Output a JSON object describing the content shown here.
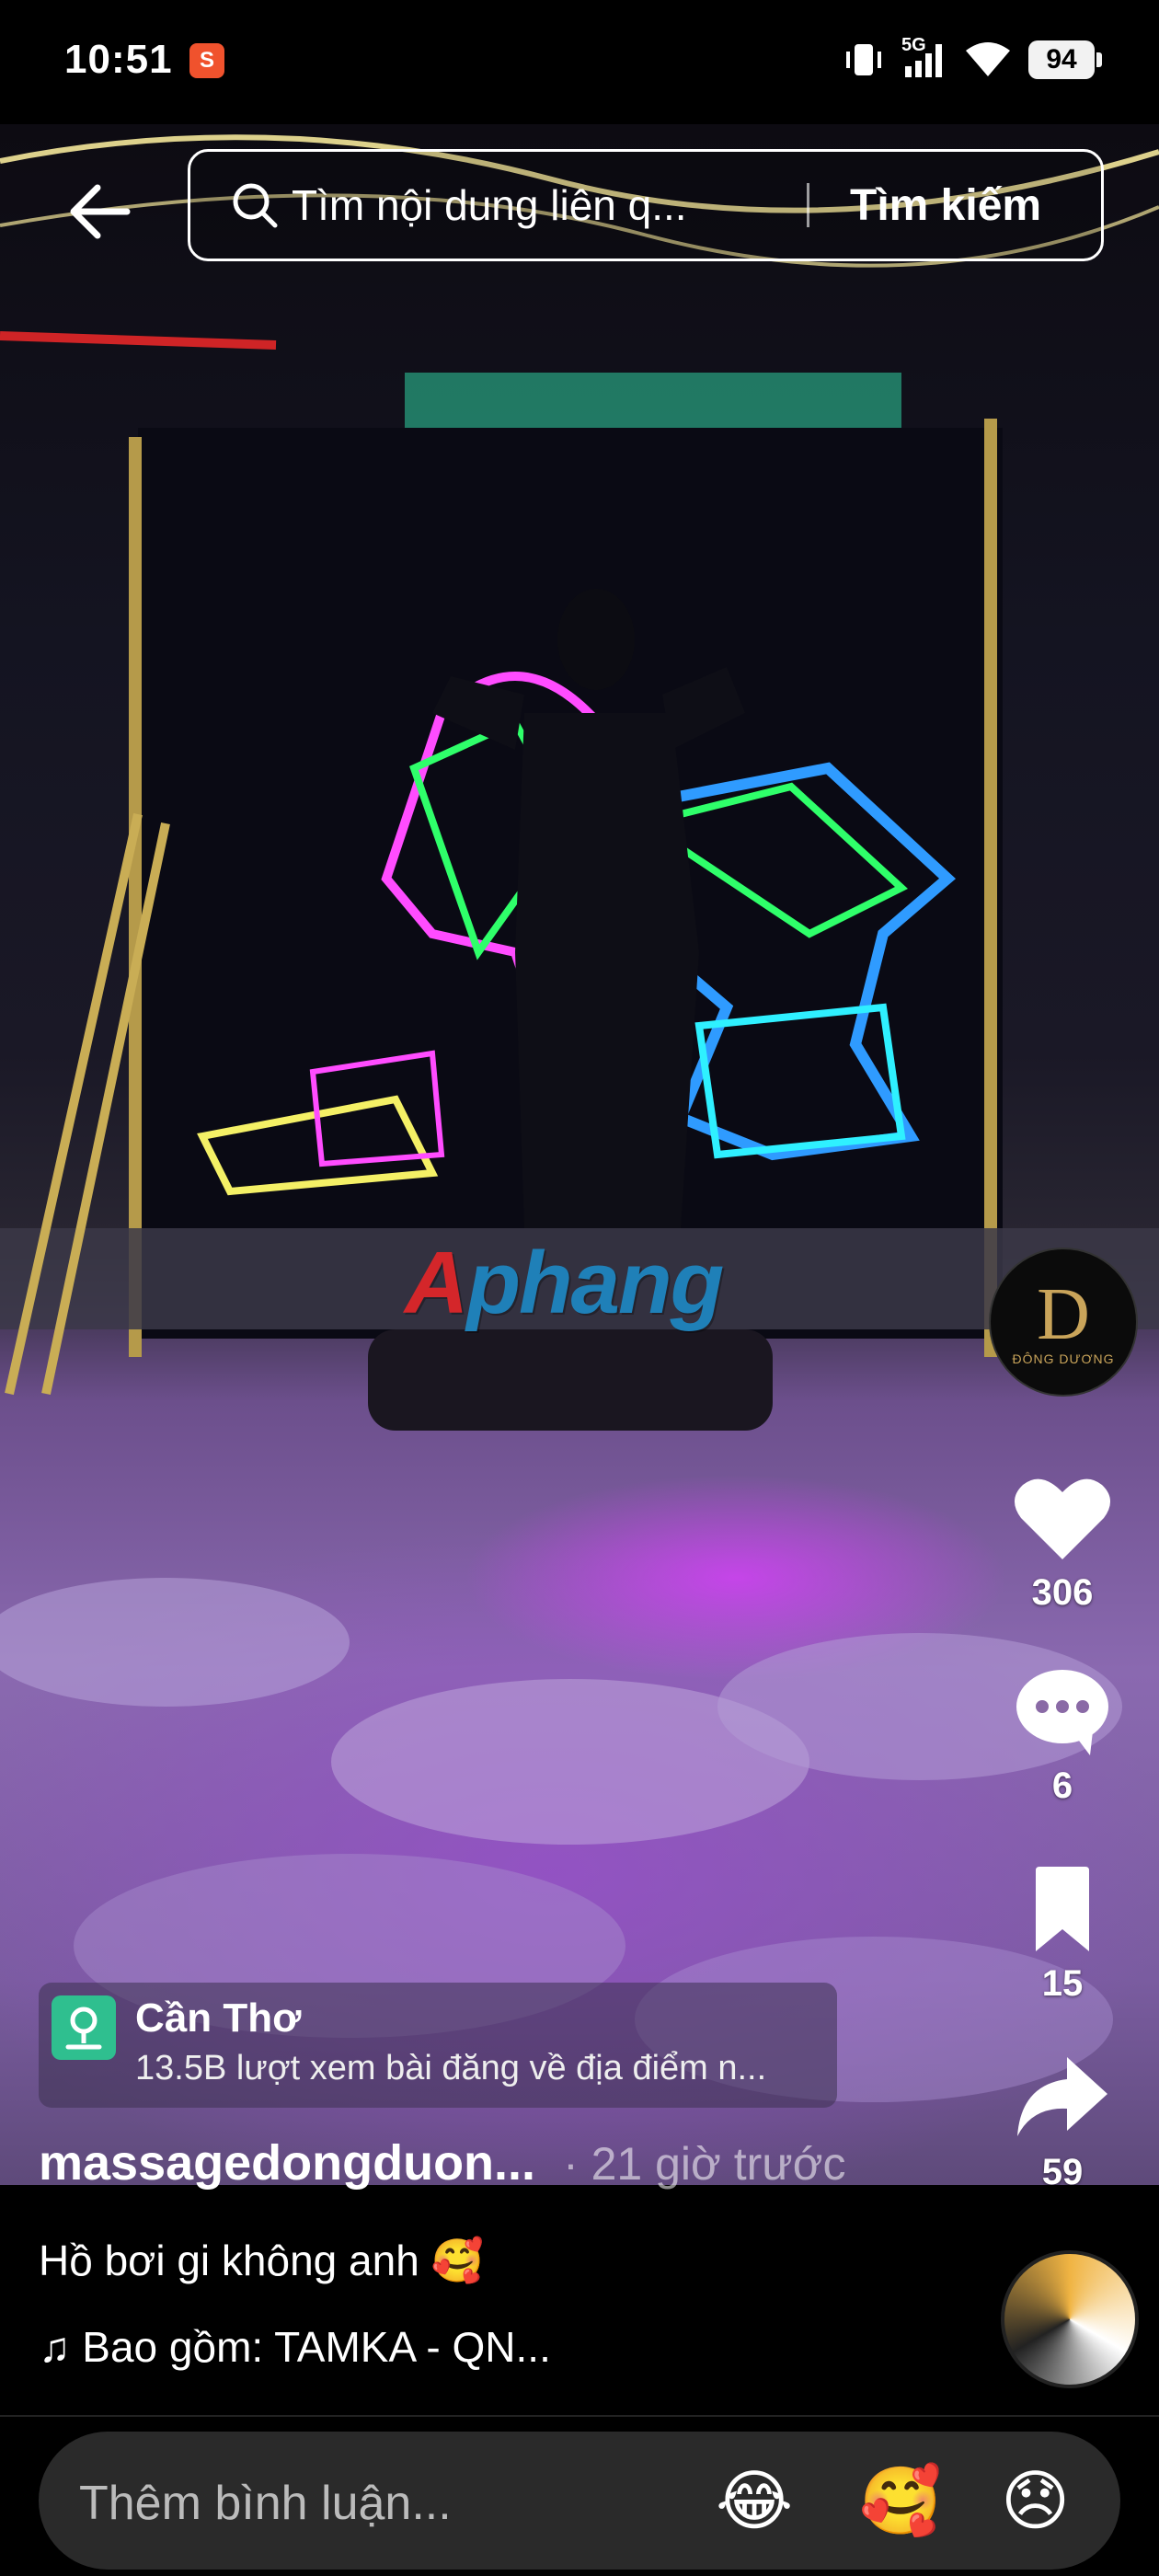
{
  "status_bar": {
    "time": "10:51",
    "notification_badge": "S",
    "network": "5G",
    "battery": "94"
  },
  "search": {
    "placeholder": "Tìm nội dung liên q...",
    "button": "Tìm kiếm"
  },
  "video": {
    "watermark_first": "A",
    "watermark_rest": "phang"
  },
  "creator_avatar": {
    "monogram": "D",
    "subtitle": "ĐÔNG DƯƠNG"
  },
  "actions": {
    "likes": "306",
    "comments": "6",
    "saves": "15",
    "shares": "59"
  },
  "location": {
    "name": "Cần Thơ",
    "sub": "13.5B lượt xem bài đăng về địa điểm n..."
  },
  "post": {
    "username": "massagedongduon...",
    "posted": "· 21 giờ trước",
    "description": "Hồ bơi gi không anh 🥰",
    "music": "♫ Bao gồm: TAMKA - QN..."
  },
  "comment_bar": {
    "placeholder": "Thêm bình luận...",
    "emoji_1": "😂",
    "emoji_2": "🥰",
    "emoji_3": "😞"
  },
  "colors": {
    "like_icon": "#ffffff",
    "location_pin_bg": "#2fbf8f",
    "watermark_red": "#d4262a",
    "watermark_blue": "#1f80b8"
  }
}
